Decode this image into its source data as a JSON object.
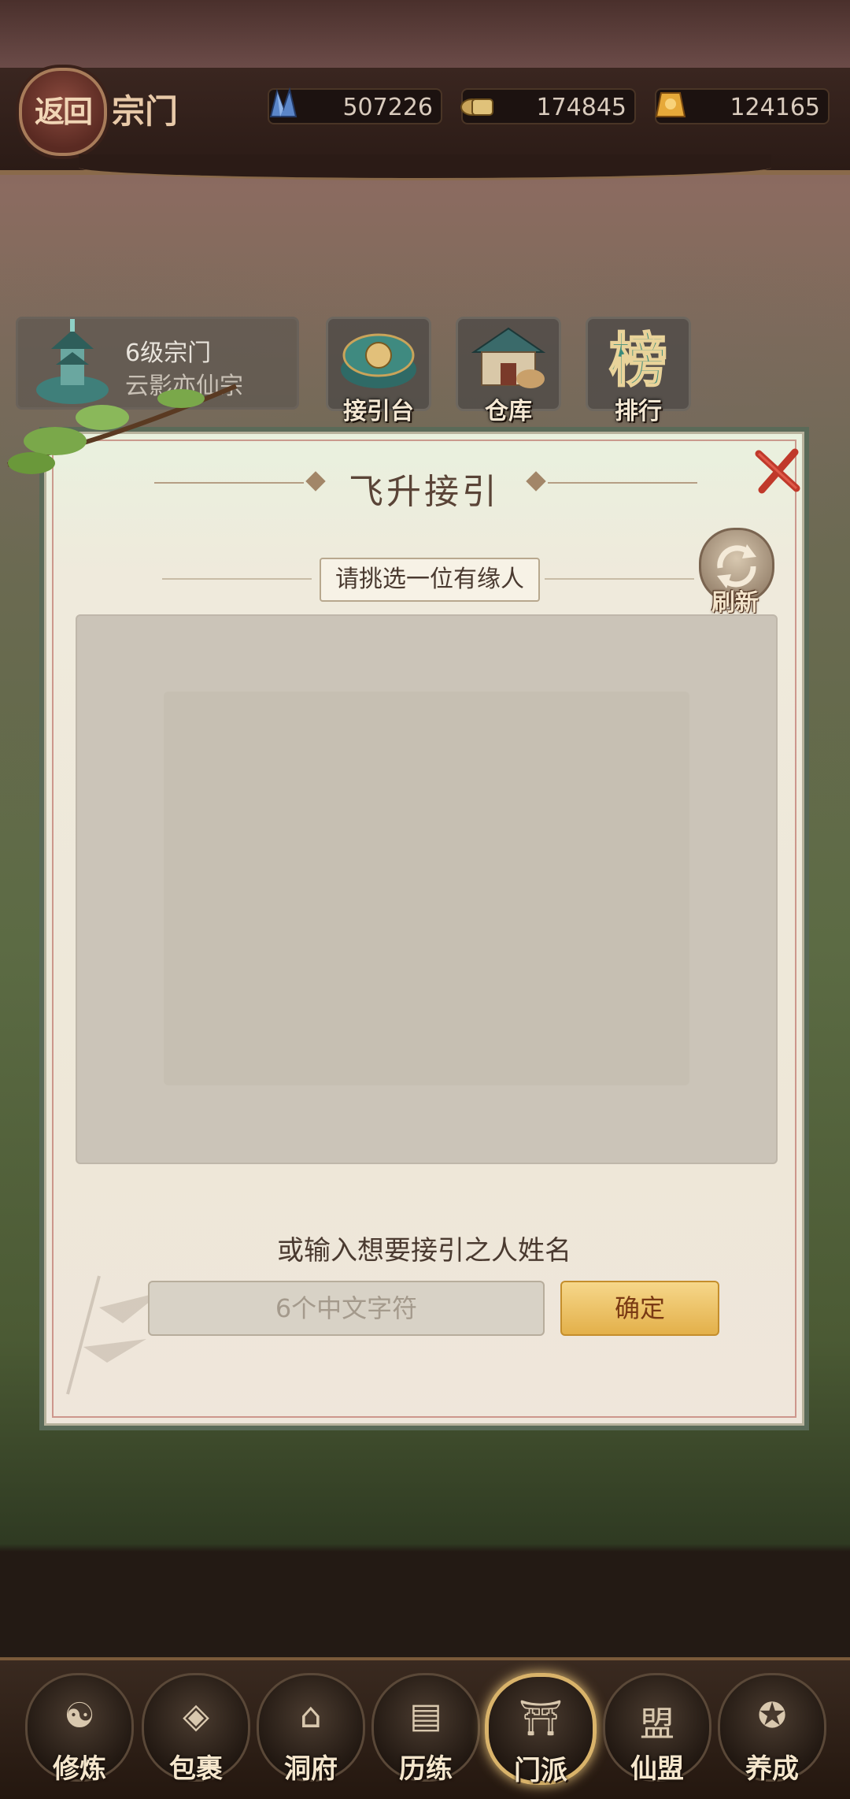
{
  "header": {
    "back_label": "返回",
    "title": "宗门",
    "resources": [
      {
        "icon": "crystal-icon",
        "value": "507226"
      },
      {
        "icon": "scroll-icon",
        "value": "174845"
      },
      {
        "icon": "gold-ingot-icon",
        "value": "124165"
      }
    ]
  },
  "sect": {
    "level": "6级宗门",
    "name": "云影亦仙宗"
  },
  "tiles": [
    {
      "label": "接引台",
      "icon": "altar-icon"
    },
    {
      "label": "仓库",
      "icon": "warehouse-icon"
    },
    {
      "label": "排行",
      "icon": "ranking-icon",
      "glyph": "榜"
    }
  ],
  "dialog": {
    "title": "飞升接引",
    "subtitle": "请挑选一位有缘人",
    "refresh_label": "刷新",
    "prompt": "或输入想要接引之人姓名",
    "input_placeholder": "6个中文字符",
    "confirm_label": "确定"
  },
  "bottom_nav": [
    {
      "label": "修炼",
      "icon": "cultivator-icon",
      "active": false
    },
    {
      "label": "包裹",
      "icon": "bag-icon",
      "active": false
    },
    {
      "label": "洞府",
      "icon": "cave-house-icon",
      "active": false
    },
    {
      "label": "历练",
      "icon": "scroll-map-icon",
      "active": false
    },
    {
      "label": "门派",
      "icon": "sect-gate-icon",
      "active": true
    },
    {
      "label": "仙盟",
      "icon": "alliance-icon",
      "glyph": "盟",
      "active": false
    },
    {
      "label": "养成",
      "icon": "pentagram-icon",
      "active": false
    }
  ],
  "colors": {
    "accent_gold": "#e3b04a",
    "dialog_bg": "#eee7d8",
    "close_red": "#c0392b"
  }
}
